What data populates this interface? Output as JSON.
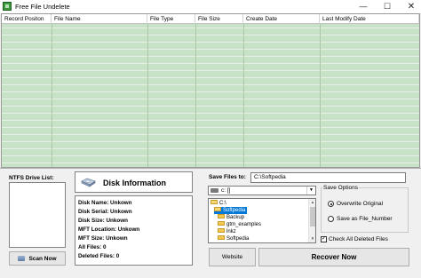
{
  "window": {
    "title": "Free File Undelete",
    "controls": {
      "minimize": "—",
      "maximize": "☐",
      "close": "✕"
    }
  },
  "grid": {
    "columns": [
      "Record Positon",
      "File Name",
      "File Type",
      "File Size",
      "Create Date",
      "Last Modify Date"
    ],
    "background_color": "#c8e2c8"
  },
  "drive_panel": {
    "label": "NTFS Drive List:",
    "scan_button": "Scan Now"
  },
  "disk_info": {
    "title": "Disk Information",
    "lines": [
      "Disk Name: Unkown",
      "Disk Serial: Unkown",
      "Disk Size: Unkown",
      "MFT Location: Unkown",
      "MFT Size: Unkown",
      "All Files: 0",
      "Deleted Files: 0"
    ]
  },
  "save": {
    "label": "Save Files to:",
    "path_value": "C:\\Softpedia",
    "drive_value": "c: []",
    "tree": [
      "C:\\",
      "Softpedia",
      "Backup",
      "gtm_examples",
      "lnkz",
      "Softpedia"
    ],
    "selected_item": "Softpedia"
  },
  "save_options": {
    "title": "Save Options",
    "overwrite_label": "Overwrite Original",
    "save_as_label": "Save as File_Number",
    "selected": "Overwrite Original",
    "check_all_label": "Check All Deleted Files",
    "check_all_checked": true
  },
  "buttons": {
    "website": "Website",
    "recover": "Recover Now"
  }
}
